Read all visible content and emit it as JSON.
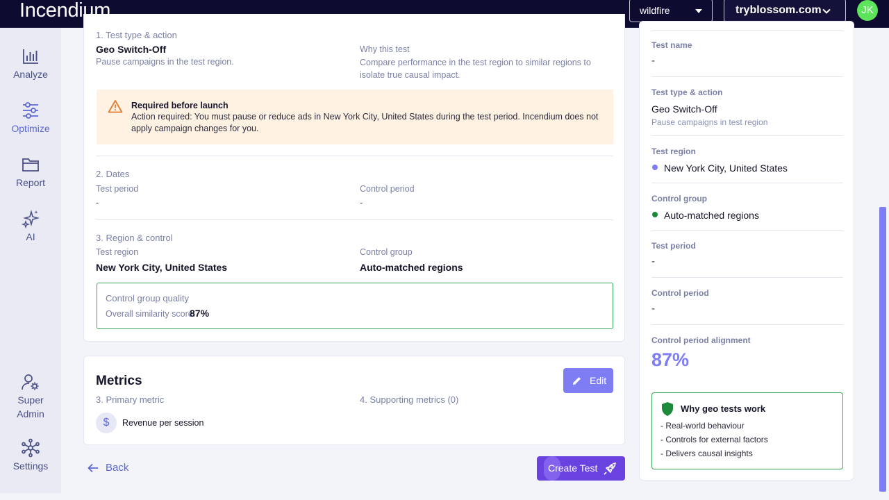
{
  "app": {
    "logo": "Incendium",
    "selector_project": "wildfire",
    "selector_site": "tryblossom.com",
    "avatar_initials": "JK"
  },
  "sidebar": {
    "items": [
      {
        "label": "Analyze",
        "icon": "bar-chart-icon"
      },
      {
        "label": "Optimize",
        "icon": "sliders-icon",
        "active": true
      },
      {
        "label": "Report",
        "icon": "folder-icon"
      },
      {
        "label": "AI",
        "icon": "sparkles-icon"
      },
      {
        "label_line1": "Super",
        "label_line2": "Admin",
        "icon": "user-gear-icon"
      },
      {
        "label": "Settings",
        "icon": "network-icon"
      }
    ]
  },
  "summary": {
    "section1_title": "1. Test type & action",
    "test_type": "Geo Switch-Off",
    "test_type_desc": "Pause campaigns in the test region.",
    "why_label": "Why this test",
    "why_desc": "Compare performance in the test region to similar regions to isolate true causal impact.",
    "warning_title": "Required before launch",
    "warning_text": "Action required: You must pause or reduce ads in New York City, United States during the test period. Incendium does not apply campaign changes for you.",
    "section2_title": "2. Dates",
    "test_period_label": "Test period",
    "test_period_value": "-",
    "control_period_label": "Control period",
    "control_period_value": "-",
    "section3_title": "3. Region & control",
    "test_region_label": "Test region",
    "test_region_value": "New York City, United States",
    "control_group_label": "Control group",
    "control_group_value": "Auto-matched regions",
    "quality_title": "Control group quality",
    "quality_label": "Overall similarity score:",
    "quality_score": "87%"
  },
  "metrics": {
    "title": "Metrics",
    "edit_label": "Edit",
    "primary_label": "3. Primary metric",
    "primary_value": "Revenue per session",
    "supporting_label": "4. Supporting metrics (0)"
  },
  "footer": {
    "back_label": "Back",
    "create_label": "Create Test"
  },
  "panel": {
    "test_name_label": "Test name",
    "test_name_value": "-",
    "type_label": "Test type & action",
    "type_value": "Geo Switch-Off",
    "type_sub": "Pause campaigns in test region",
    "region_label": "Test region",
    "region_value": "New York City, United States",
    "control_label": "Control group",
    "control_value": "Auto-matched regions",
    "test_period_label": "Test period",
    "test_period_value": "-",
    "control_period_label": "Control period",
    "control_period_value": "-",
    "alignment_label": "Control period alignment",
    "alignment_value": "87%",
    "why_title": "Why geo tests work",
    "why_items": [
      "- Real-world behaviour",
      "- Controls for external factors",
      "- Delivers causal insights"
    ]
  },
  "colors": {
    "topbar": "#0d0b30",
    "accent": "#7f7df4",
    "primary_button": "#6a42e0",
    "success": "#3aa35a",
    "warning_bg": "#fff2e3",
    "warning_icon": "#e07a2e",
    "region_dot": "#7f7df4",
    "control_dot": "#1c8a3a"
  }
}
